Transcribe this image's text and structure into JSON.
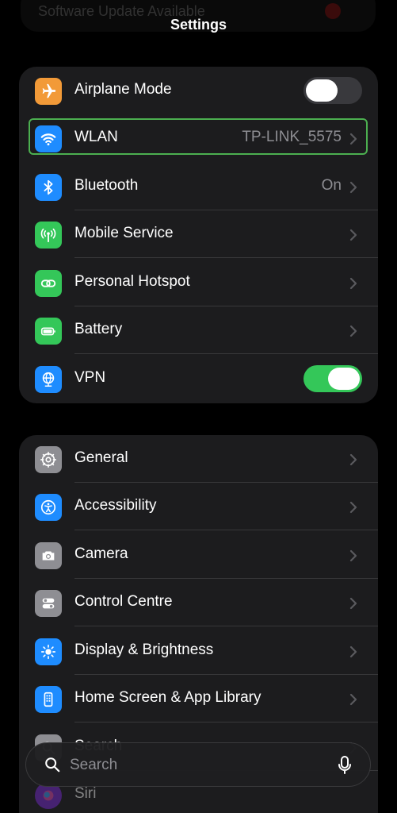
{
  "header": {
    "scrolled_item_label": "Software Update Available",
    "title": "Settings"
  },
  "group_connectivity": {
    "rows": [
      {
        "label": "Airplane Mode",
        "icon": "airplane-icon",
        "icon_color": "#f29a38",
        "control": "toggle",
        "toggle_state": "off"
      },
      {
        "label": "WLAN",
        "icon": "wifi-icon",
        "icon_color": "#1e8cff",
        "value": "TP-LINK_5575",
        "control": "chevron",
        "highlighted": true
      },
      {
        "label": "Bluetooth",
        "icon": "bluetooth-icon",
        "icon_color": "#1e8cff",
        "value": "On",
        "control": "chevron"
      },
      {
        "label": "Mobile Service",
        "icon": "antenna-icon",
        "icon_color": "#34c759",
        "control": "chevron"
      },
      {
        "label": "Personal Hotspot",
        "icon": "link-icon",
        "icon_color": "#34c759",
        "control": "chevron"
      },
      {
        "label": "Battery",
        "icon": "battery-icon",
        "icon_color": "#34c759",
        "control": "chevron"
      },
      {
        "label": "VPN",
        "icon": "globe-icon",
        "icon_color": "#1e8cff",
        "control": "toggle",
        "toggle_state": "on"
      }
    ]
  },
  "group_general": {
    "rows": [
      {
        "label": "General",
        "icon": "gear-icon",
        "icon_color": "#8e8e93",
        "control": "chevron"
      },
      {
        "label": "Accessibility",
        "icon": "accessibility-icon",
        "icon_color": "#1e8cff",
        "control": "chevron"
      },
      {
        "label": "Camera",
        "icon": "camera-icon",
        "icon_color": "#8e8e93",
        "control": "chevron"
      },
      {
        "label": "Control Centre",
        "icon": "switches-icon",
        "icon_color": "#8e8e93",
        "control": "chevron"
      },
      {
        "label": "Display & Brightness",
        "icon": "sun-icon",
        "icon_color": "#1e8cff",
        "control": "chevron"
      },
      {
        "label": "Home Screen & App Library",
        "icon": "phone-grid-icon",
        "icon_color": "#1e8cff",
        "control": "chevron"
      },
      {
        "label": "Search",
        "icon": "search-icon",
        "icon_color": "#8e8e93",
        "control": "chevron"
      },
      {
        "label": "Siri",
        "icon": "siri-icon",
        "icon_color": "#7a2bd6",
        "control": "chevron"
      }
    ]
  },
  "search": {
    "placeholder": "Search"
  },
  "colors": {
    "background": "#000000",
    "group_background": "#1c1c1e",
    "toggle_on": "#34c759",
    "highlight_border": "#4caf50"
  }
}
